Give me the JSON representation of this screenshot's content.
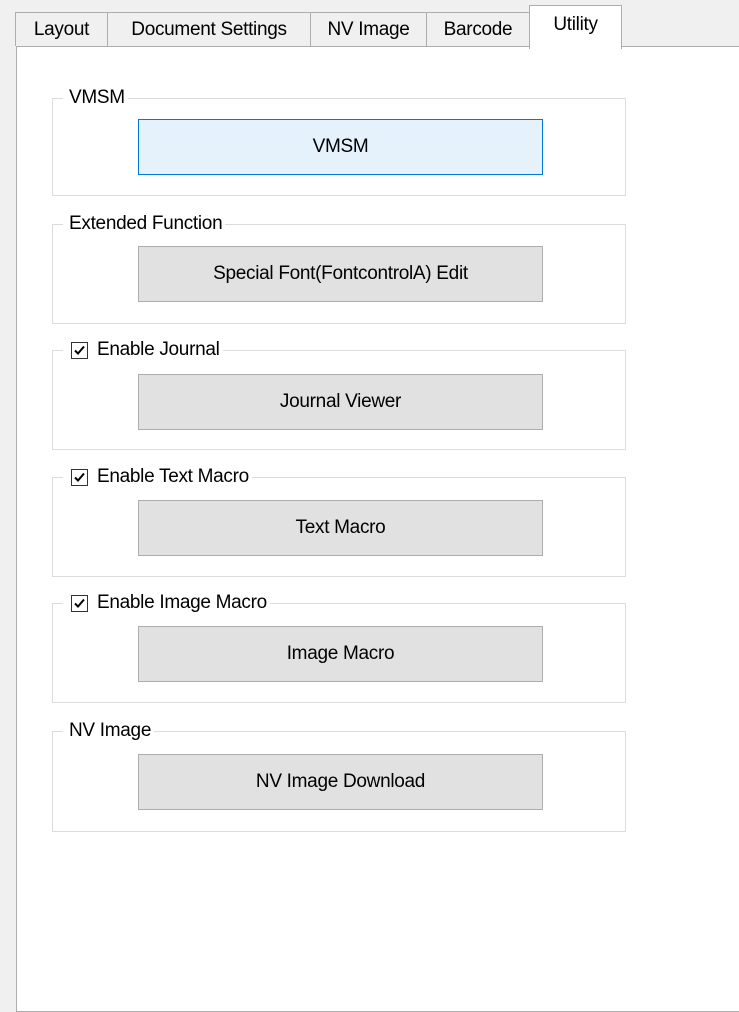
{
  "tabs": [
    {
      "label": "Layout"
    },
    {
      "label": "Document Settings"
    },
    {
      "label": "NV Image"
    },
    {
      "label": "Barcode"
    },
    {
      "label": "Utility"
    }
  ],
  "active_tab": "Utility",
  "groups": {
    "vmsm": {
      "title": "VMSM",
      "button_label": "VMSM"
    },
    "extended_function": {
      "title": "Extended Function",
      "button_label": "Special Font(FontcontrolA) Edit"
    },
    "journal": {
      "title": "Enable Journal",
      "checked": true,
      "button_label": "Journal Viewer"
    },
    "text_macro": {
      "title": "Enable Text Macro",
      "checked": true,
      "button_label": "Text Macro"
    },
    "image_macro": {
      "title": "Enable Image Macro",
      "checked": true,
      "button_label": "Image Macro"
    },
    "nv_image": {
      "title": "NV Image",
      "button_label": "NV Image Download"
    }
  },
  "colors": {
    "tab_background": "#f0f0f0",
    "border": "#adadad",
    "button_face": "#e1e1e1",
    "focus_border": "#0078d7",
    "focus_face": "#e5f1fb"
  }
}
